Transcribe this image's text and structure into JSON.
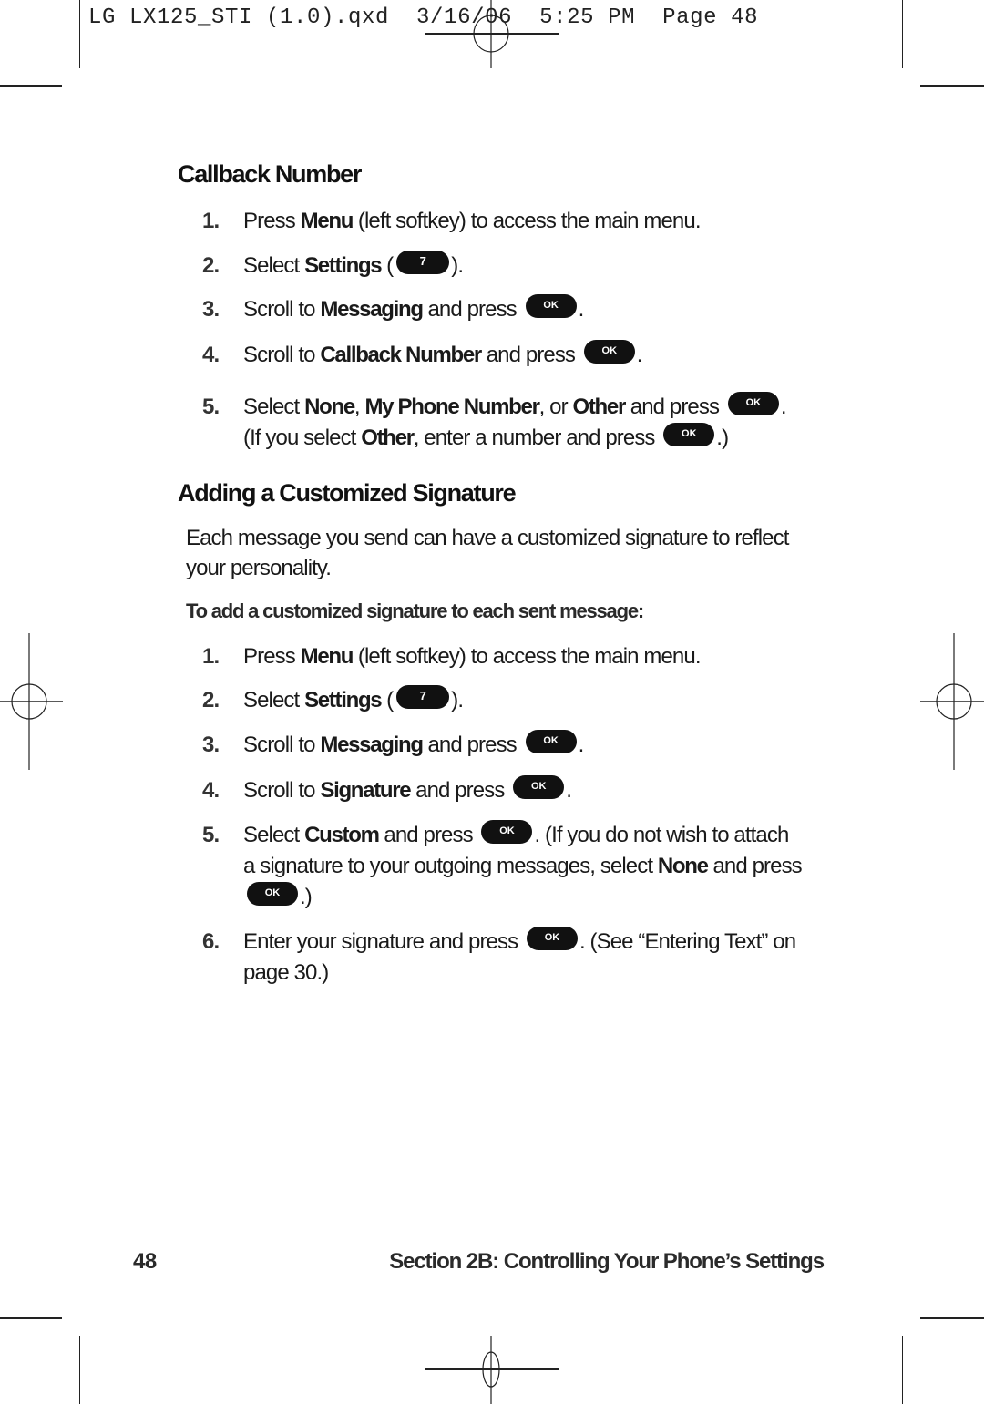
{
  "slug": "LG LX125_STI (1.0).qxd  3/16/06  5:25 PM  Page 48",
  "sections": [
    {
      "title": "Callback Number",
      "steps": [
        {
          "num": "1.",
          "parts": [
            {
              "t": "Press "
            },
            {
              "b": "Menu"
            },
            {
              "t": " (left softkey) to access the main menu."
            }
          ]
        },
        {
          "num": "2.",
          "parts": [
            {
              "t": "Select "
            },
            {
              "b": "Settings"
            },
            {
              "t": " ("
            },
            {
              "key": "7"
            },
            {
              "t": ")."
            }
          ]
        },
        {
          "num": "3.",
          "parts": [
            {
              "t": "Scroll to "
            },
            {
              "b": "Messaging"
            },
            {
              "t": " and press "
            },
            {
              "key": "OK"
            },
            {
              "t": "."
            }
          ]
        },
        {
          "num": "4.",
          "parts": [
            {
              "t": "Scroll to "
            },
            {
              "b": "Callback Number"
            },
            {
              "t": " and press "
            },
            {
              "key": "OK"
            },
            {
              "t": "."
            }
          ]
        },
        {
          "num": "5.",
          "parts": [
            {
              "t": "Select "
            },
            {
              "b": "None"
            },
            {
              "t": ", "
            },
            {
              "b": "My Phone Number"
            },
            {
              "t": ", or "
            },
            {
              "b": "Other"
            },
            {
              "t": " and press "
            },
            {
              "key": "OK"
            },
            {
              "t": ". (If you select "
            },
            {
              "b": "Other"
            },
            {
              "t": ", enter a number and press "
            },
            {
              "key": "OK"
            },
            {
              "t": ".)"
            }
          ]
        }
      ]
    },
    {
      "title": "Adding a Customized Signature",
      "intro": "Each message you send can have a customized signature to reflect your personality.",
      "subheading": "To add a customized signature to each sent message:",
      "steps": [
        {
          "num": "1.",
          "parts": [
            {
              "t": "Press "
            },
            {
              "b": "Menu"
            },
            {
              "t": " (left softkey) to access the main menu."
            }
          ]
        },
        {
          "num": "2.",
          "parts": [
            {
              "t": "Select "
            },
            {
              "b": "Settings"
            },
            {
              "t": " ("
            },
            {
              "key": "7"
            },
            {
              "t": ")."
            }
          ]
        },
        {
          "num": "3.",
          "parts": [
            {
              "t": "Scroll to "
            },
            {
              "b": "Messaging"
            },
            {
              "t": " and press "
            },
            {
              "key": "OK"
            },
            {
              "t": "."
            }
          ]
        },
        {
          "num": "4.",
          "parts": [
            {
              "t": "Scroll to "
            },
            {
              "b": "Signature"
            },
            {
              "t": " and press "
            },
            {
              "key": "OK"
            },
            {
              "t": "."
            }
          ]
        },
        {
          "num": "5.",
          "parts": [
            {
              "t": "Select "
            },
            {
              "b": "Custom"
            },
            {
              "t": " and press "
            },
            {
              "key": "OK"
            },
            {
              "t": ". (If you do not wish to attach a signature to your outgoing messages, select "
            },
            {
              "b": "None"
            },
            {
              "t": " and press "
            },
            {
              "key": "OK"
            },
            {
              "t": ".)"
            }
          ]
        },
        {
          "num": "6.",
          "parts": [
            {
              "t": "Enter your signature and press "
            },
            {
              "key": "OK"
            },
            {
              "t": ". (See “Entering Text” on page 30.)"
            }
          ]
        }
      ]
    }
  ],
  "footer": {
    "page_number": "48",
    "section": "Section 2B: Controlling Your Phone’s Settings"
  }
}
